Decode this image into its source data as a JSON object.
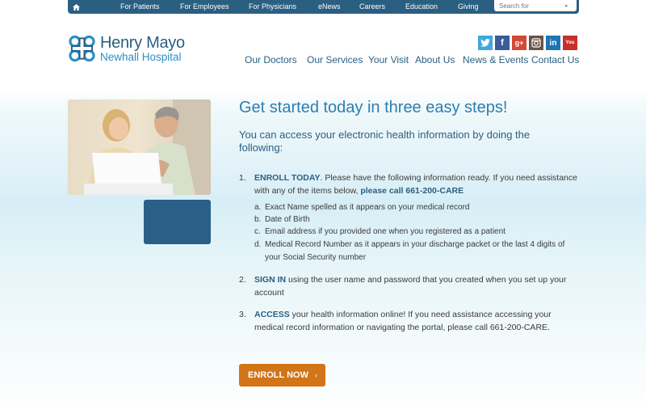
{
  "topnav": {
    "items": [
      {
        "label": "For Patients"
      },
      {
        "label": "For Employees"
      },
      {
        "label": "For Physicians"
      },
      {
        "label": "eNews"
      },
      {
        "label": "Careers"
      },
      {
        "label": "Education"
      },
      {
        "label": "Giving"
      }
    ],
    "search_placeholder": "Search for"
  },
  "logo": {
    "line1": "Henry Mayo",
    "line2": "Newhall Hospital"
  },
  "social": [
    {
      "icon": "twitter-icon",
      "glyph": "t",
      "color": "#3fa7dc"
    },
    {
      "icon": "facebook-icon",
      "glyph": "f",
      "color": "#3b5b99"
    },
    {
      "icon": "google-plus-icon",
      "glyph": "g+",
      "color": "#d34836"
    },
    {
      "icon": "instagram-icon",
      "glyph": "",
      "color": "#6b5346"
    },
    {
      "icon": "linkedin-icon",
      "glyph": "in",
      "color": "#1d75b3"
    },
    {
      "icon": "youtube-icon",
      "glyph": "You",
      "color": "#c9302c"
    }
  ],
  "mainnav": [
    {
      "label": "Our Doctors"
    },
    {
      "label": "Our Services"
    },
    {
      "label": "Your Visit"
    },
    {
      "label": "About Us"
    },
    {
      "label": "News & Events"
    },
    {
      "label": "Contact Us"
    }
  ],
  "content": {
    "headline": "Get started today in three easy steps!",
    "intro": "You can access your electronic health information by doing the following:",
    "steps": [
      {
        "num": "1.",
        "bold": "ENROLL TODAY",
        "text": ". Please have the following information ready. If you need assistance with any of the items below, ",
        "bold2": "please call 661-200-CARE"
      },
      {
        "num": "2.",
        "bold": "SIGN IN",
        "text": " using the user name and password that you created when you set up your account"
      },
      {
        "num": "3.",
        "bold": "ACCESS",
        "text": " your health information online! If you need assistance accessing your medical record information or navigating the portal, please call 661-200-CARE."
      }
    ],
    "sub_items": [
      {
        "letter": "a.",
        "text": "Exact Name spelled as it appears on your medical record"
      },
      {
        "letter": "b.",
        "text": "Date of Birth"
      },
      {
        "letter": "c.",
        "text": "Email address if you provided one when you registered as a patient"
      },
      {
        "letter": "d.",
        "text": "Medical Record Number as it appears in your discharge packet or the last 4 digits of your Social Security number"
      }
    ],
    "enroll_button": "ENROLL NOW",
    "enroll_chevron": "›"
  },
  "colors": {
    "nav_blue": "#2a5f82",
    "accent_blue": "#2b7eb0",
    "button_orange": "#d27418"
  }
}
